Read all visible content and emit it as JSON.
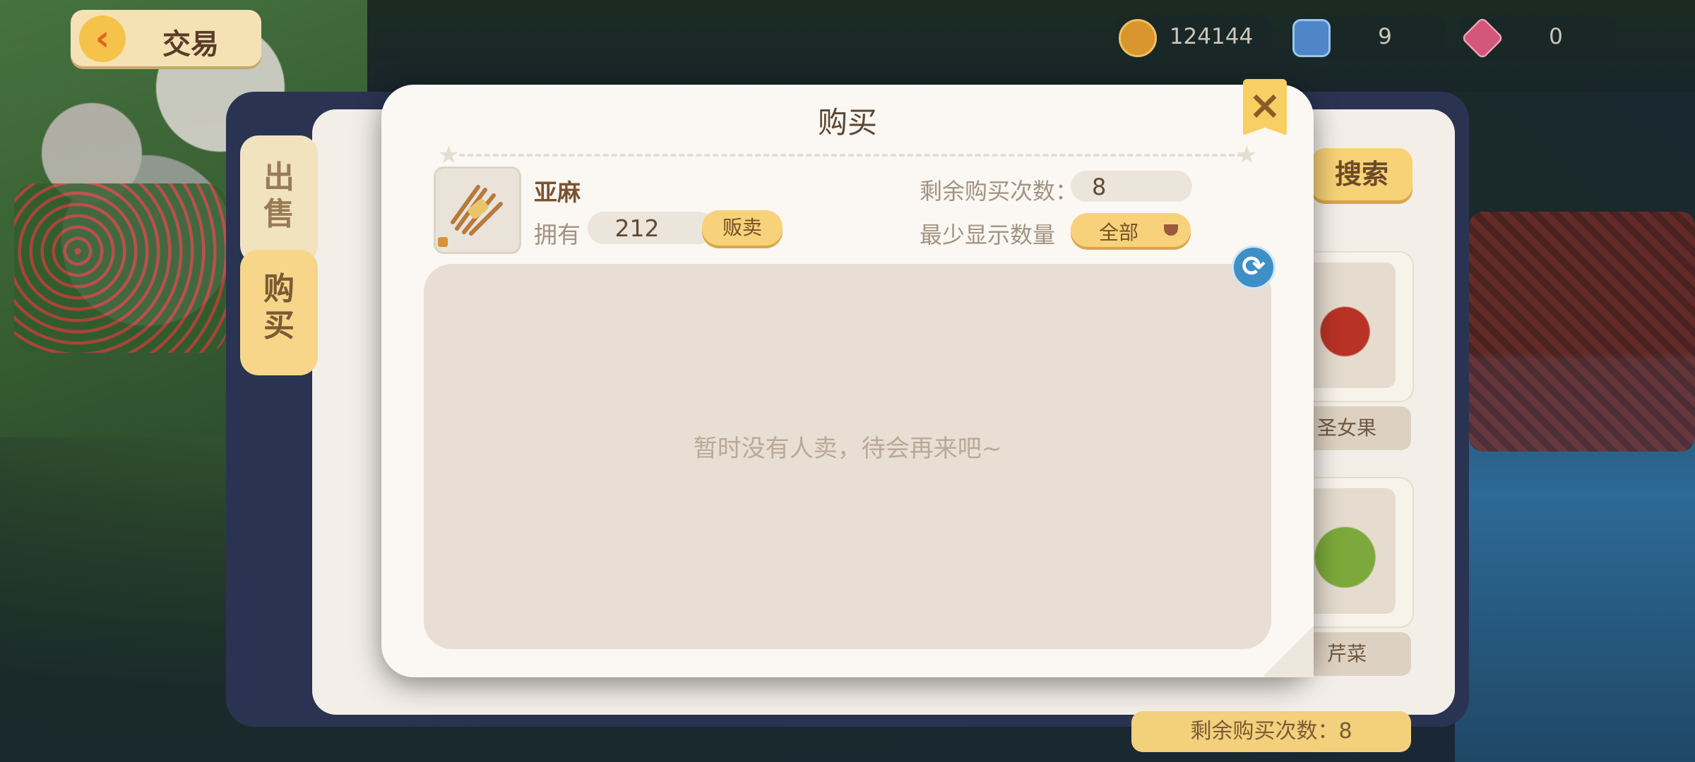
{
  "header": {
    "back_label": "交易"
  },
  "currency": {
    "coins": "124144",
    "gems_blue": "9",
    "diamonds": "0",
    "coin_icon": "coin-icon",
    "blue_icon": "blue-crystal-plus-icon",
    "diamond_icon": "pink-diamond-plus-icon"
  },
  "trade_panel": {
    "tab_sell": [
      "出",
      "售"
    ],
    "tab_buy": [
      "购",
      "买"
    ],
    "search_label": "搜索",
    "cards": [
      {
        "label": "圣女果"
      },
      {
        "label": "芹菜"
      }
    ],
    "remain_text": "剩余购买次数：8"
  },
  "modal": {
    "title": "购买",
    "item_name": "亚麻",
    "own_label": "拥有",
    "own_value": "212",
    "sell_label": "贩卖",
    "remain_label": "剩余购买次数：",
    "remain_value": "8",
    "min_label": "最少显示数量",
    "filter_value": "全部",
    "empty_text": "暂时没有人卖，待会再来吧~"
  },
  "colors": {
    "accent_yellow": "#f7d27a",
    "modal_bg": "#fbf7f2",
    "list_bg": "#e9ded4",
    "refresh_blue": "#3f8fc7"
  }
}
